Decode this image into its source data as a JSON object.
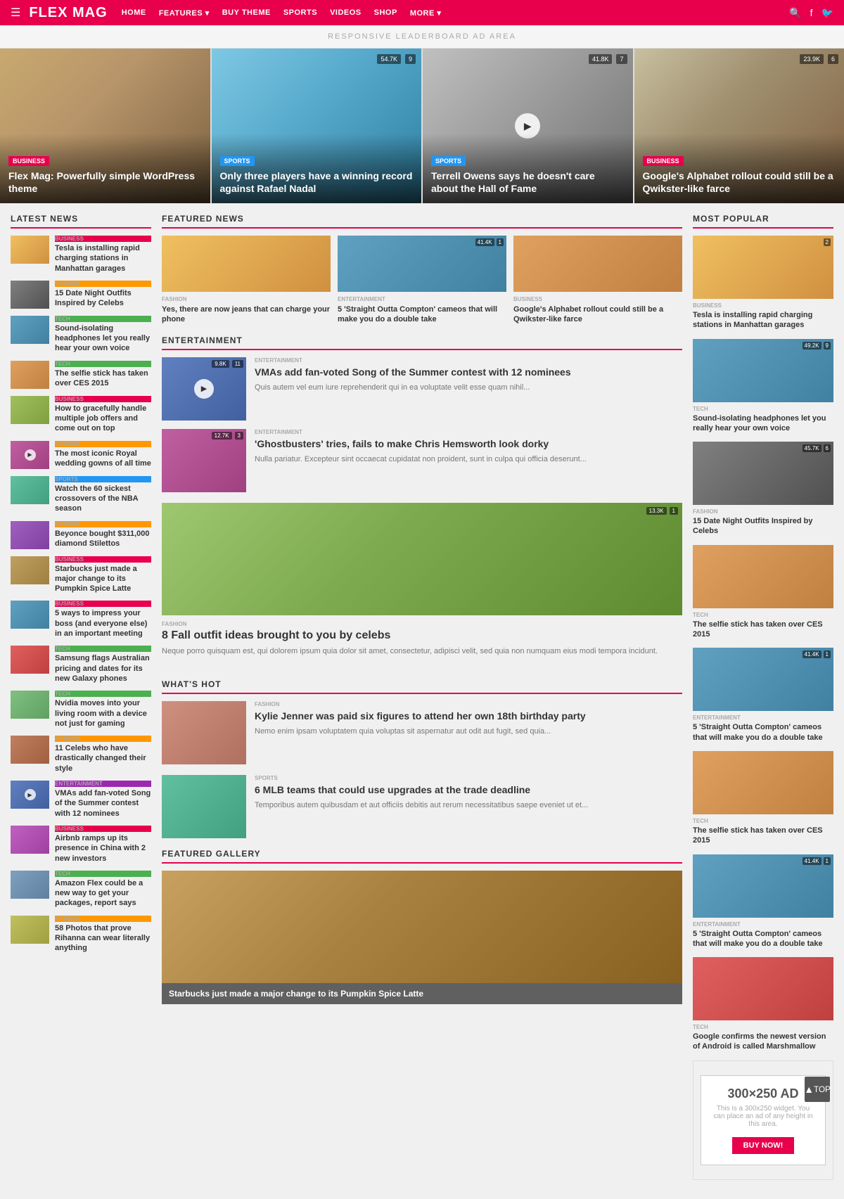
{
  "navbar": {
    "logo": "FLEX MAG",
    "links": [
      "HOME",
      "FEATURES",
      "BUY THEME",
      "SPORTS",
      "VIDEOS",
      "SHOP",
      "MORE"
    ],
    "features_has_dropdown": true,
    "more_has_dropdown": true
  },
  "ad_banner": "RESPONSIVE LEADERBOARD AD AREA",
  "hero": {
    "items": [
      {
        "category": "BUSINESS",
        "category_class": "cat-business",
        "title": "Flex Mag: Powerfully simple WordPress theme",
        "color_class": "hero-color-1",
        "has_play": false
      },
      {
        "category": "SPORTS",
        "category_class": "cat-sports",
        "title": "Only three players have a winning record against Rafael Nadal",
        "color_class": "hero-color-2",
        "meta_views": "54.7K",
        "meta_comments": "9",
        "has_play": false
      },
      {
        "category": "SPORTS",
        "category_class": "cat-sports",
        "title": "Terrell Owens says he doesn't care about the Hall of Fame",
        "color_class": "hero-color-3",
        "meta_views": "41.8K",
        "meta_comments": "7",
        "has_play": true
      },
      {
        "category": "BUSINESS",
        "category_class": "cat-business",
        "title": "Google's Alphabet rollout could still be a Qwikster-like farce",
        "color_class": "hero-color-4",
        "meta_views": "23.9K",
        "meta_comments": "6",
        "has_play": false
      }
    ]
  },
  "latest_news": {
    "header": "LATEST NEWS",
    "items": [
      {
        "category": "BUSINESS",
        "title": "Tesla is installing rapid charging stations in Manhattan garages",
        "thumb_class": "thumb-color-1",
        "has_play": false
      },
      {
        "category": "FASHION",
        "title": "15 Date Night Outfits Inspired by Celebs",
        "thumb_class": "thumb-color-2",
        "has_play": false
      },
      {
        "category": "TECH",
        "title": "Sound-isolating headphones let you really hear your own voice",
        "thumb_class": "thumb-color-3",
        "has_play": false
      },
      {
        "category": "TECH",
        "title": "The selfie stick has taken over CES 2015",
        "thumb_class": "thumb-color-4",
        "has_play": false
      },
      {
        "category": "BUSINESS",
        "title": "How to gracefully handle multiple job offers and come out on top",
        "thumb_class": "thumb-color-5",
        "has_play": false
      },
      {
        "category": "FASHION",
        "title": "The most iconic Royal wedding gowns of all time",
        "thumb_class": "thumb-color-6",
        "has_play": true
      },
      {
        "category": "SPORTS",
        "title": "Watch the 60 sickest crossovers of the NBA season",
        "thumb_class": "thumb-color-7",
        "has_play": false
      },
      {
        "category": "FASHION",
        "title": "Beyonce bought $311,000 diamond Stilettos",
        "thumb_class": "thumb-color-8",
        "has_play": false
      },
      {
        "category": "BUSINESS",
        "title": "Starbucks just made a major change to its Pumpkin Spice Latte",
        "thumb_class": "thumb-color-9",
        "has_play": false
      },
      {
        "category": "BUSINESS",
        "title": "5 ways to impress your boss (and everyone else) in an important meeting",
        "thumb_class": "thumb-color-10",
        "has_play": false
      },
      {
        "category": "TECH",
        "title": "Samsung flags Australian pricing and dates for its new Galaxy phones",
        "thumb_class": "thumb-color-11",
        "has_play": false
      },
      {
        "category": "TECH",
        "title": "Nvidia moves into your living room with a device not just for gaming",
        "thumb_class": "thumb-color-12",
        "has_play": false
      },
      {
        "category": "FASHION",
        "title": "11 Celebs who have drastically changed their style",
        "thumb_class": "thumb-color-13",
        "has_play": false
      },
      {
        "category": "ENTERTAINMENT",
        "title": "VMAs add fan-voted Song of the Summer contest with 12 nominees",
        "thumb_class": "thumb-color-14",
        "has_play": true
      },
      {
        "category": "BUSINESS",
        "title": "Airbnb ramps up its presence in China with 2 new investors",
        "thumb_class": "thumb-color-15",
        "has_play": false
      },
      {
        "category": "TECH",
        "title": "Amazon Flex could be a new way to get your packages, report says",
        "thumb_class": "thumb-color-16",
        "has_play": false
      },
      {
        "category": "FASHION",
        "title": "58 Photos that prove Rihanna can wear literally anything",
        "thumb_class": "thumb-color-17",
        "has_play": false
      }
    ]
  },
  "featured_news": {
    "header": "FEATURED NEWS",
    "items": [
      {
        "category": "FASHION",
        "title": "Yes, there are now jeans that can charge your phone",
        "thumb_class": "thumb-color-1",
        "excerpt": ""
      },
      {
        "category": "ENTERTAINMENT",
        "title": "5 'Straight Outta Compton' cameos that will make you do a double take",
        "thumb_class": "thumb-color-3",
        "meta_views": "41.4K",
        "meta_comments": "1",
        "excerpt": ""
      },
      {
        "category": "BUSINESS",
        "title": "Google's Alphabet rollout could still be a Qwikster-like farce",
        "thumb_class": "thumb-color-4",
        "excerpt": ""
      }
    ]
  },
  "entertainment": {
    "header": "ENTERTAINMENT",
    "items": [
      {
        "category": "ENTERTAINMENT",
        "title": "VMAs add fan-voted Song of the Summer contest with 12 nominees",
        "excerpt": "Quis autem vel eum iure reprehenderit qui in ea voluptate velit esse quam nihil...",
        "thumb_class": "thumb-color-14",
        "meta_views": "9.8K",
        "meta_comments": "11",
        "has_play": true
      },
      {
        "category": "ENTERTAINMENT",
        "title": "'Ghostbusters' tries, fails to make Chris Hemsworth look dorky",
        "excerpt": "Nulla pariatur. Excepteur sint occaecat cupidatat non proident, sunt in culpa qui officia deserunt...",
        "thumb_class": "thumb-color-6",
        "meta_views": "12.7K",
        "meta_comments": "3",
        "has_play": false
      }
    ]
  },
  "fashion_large": {
    "category": "FASHION",
    "title": "8 Fall outfit ideas brought to you by celebs",
    "excerpt": "Neque porro quisquam est, qui dolorem ipsum quia dolor sit amet, consectetur, adipisci velit, sed quia non numquam eius modi tempora incidunt.",
    "meta_views": "13.3K",
    "meta_comments": "1"
  },
  "whats_hot": {
    "header": "WHAT'S HOT",
    "items": [
      {
        "category": "FASHION",
        "title": "Kylie Jenner was paid six figures to attend her own 18th birthday party",
        "excerpt": "Nemo enim ipsam voluptatem quia voluptas sit aspernatur aut odit aut fugit, sed quia...",
        "thumb_class": "thumb-color-19"
      },
      {
        "category": "SPORTS",
        "title": "6 MLB teams that could use upgrades at the trade deadline",
        "excerpt": "Temporibus autem quibusdam et aut officiis debitis aut rerum necessitatibus saepe eveniet ut et...",
        "thumb_class": "thumb-color-7"
      }
    ]
  },
  "featured_gallery": {
    "header": "FEATURED GALLERY",
    "title": "Starbucks just made a major change to its Pumpkin Spice Latte"
  },
  "most_popular": {
    "header": "MOST POPULAR",
    "items": [
      {
        "category": "BUSINESS",
        "title": "Tesla is installing rapid charging stations in Manhattan garages",
        "thumb_class": "thumb-color-1",
        "meta_views": "",
        "meta_comments": "2"
      },
      {
        "category": "TECH",
        "title": "Sound-isolating headphones let you really hear your own voice",
        "thumb_class": "thumb-color-3",
        "meta_views": "49.2K",
        "meta_comments": "9"
      },
      {
        "category": "FASHION",
        "title": "15 Date Night Outfits Inspired by Celebs",
        "thumb_class": "thumb-color-2",
        "meta_views": "45.7K",
        "meta_comments": "6"
      },
      {
        "category": "TECH",
        "title": "The selfie stick has taken over CES 2015",
        "thumb_class": "thumb-color-4",
        "meta_views": "",
        "meta_comments": ""
      },
      {
        "category": "ENTERTAINMENT",
        "title": "5 'Straight Outta Compton' cameos that will make you do a double take",
        "thumb_class": "thumb-color-3",
        "meta_views": "41.4K",
        "meta_comments": "1"
      },
      {
        "category": "TECH",
        "title": "The selfie stick has taken over CES 2015",
        "thumb_class": "thumb-color-4",
        "meta_views": "",
        "meta_comments": ""
      },
      {
        "category": "ENTERTAINMENT",
        "title": "5 'Straight Outta Compton' cameos that will make you do a double take",
        "thumb_class": "thumb-color-3",
        "meta_views": "41.4K",
        "meta_comments": "1"
      },
      {
        "category": "TECH",
        "title": "Google confirms the newest version of Android is called Marshmallow",
        "thumb_class": "thumb-color-11",
        "meta_views": "",
        "meta_comments": ""
      }
    ]
  },
  "ad_300": {
    "size": "300×250 AD",
    "text": "This is a 300x250 widget. You can place an ad of any height in this area.",
    "buy_label": "BUY NOW!"
  },
  "scroll_top_label": "▲\nTOP"
}
